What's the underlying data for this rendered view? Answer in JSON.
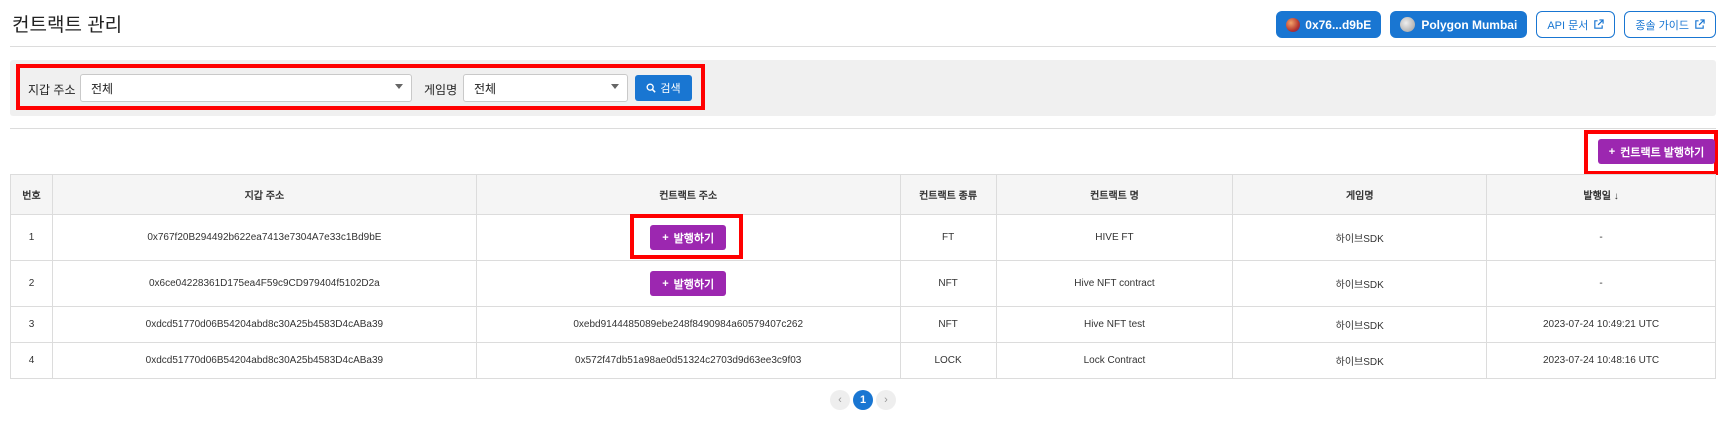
{
  "page": {
    "title": "컨트랙트 관리"
  },
  "header": {
    "wallet_label": "0x76...d9bE",
    "network_label": "Polygon Mumbai",
    "api_docs_label": "API 문서",
    "guide_label": "종솔 가이드"
  },
  "filter": {
    "wallet_label": "지갑 주소",
    "wallet_value": "전체",
    "game_label": "게임명",
    "game_value": "전체",
    "search_label": "검색"
  },
  "issue_contract_label": "컨트랙트 발행하기",
  "table": {
    "headers": [
      "번호",
      "지갑 주소",
      "컨트랙트 주소",
      "컨트랙트 종류",
      "컨트랙트 명",
      "게임명",
      "발행일 ↓"
    ],
    "issue_label": "발행하기",
    "rows": [
      {
        "no": "1",
        "wallet": "0x767f20B294492b622ea7413e7304A7e33c1Bd9bE",
        "contract": "",
        "type": "FT",
        "name": "HIVE FT",
        "game": "하이브SDK",
        "date": "-"
      },
      {
        "no": "2",
        "wallet": "0x6ce04228361D175ea4F59c9CD979404f5102D2a",
        "contract": "",
        "type": "NFT",
        "name": "Hive NFT contract",
        "game": "하이브SDK",
        "date": "-"
      },
      {
        "no": "3",
        "wallet": "0xdcd51770d06B54204abd8c30A25b4583D4cABa39",
        "contract": "0xebd9144485089ebe248f8490984a60579407c262",
        "type": "NFT",
        "name": "Hive NFT test",
        "game": "하이브SDK",
        "date": "2023-07-24 10:49:21 UTC"
      },
      {
        "no": "4",
        "wallet": "0xdcd51770d06B54204abd8c30A25b4583D4cABa39",
        "contract": "0x572f47db51a98ae0d51324c2703d9d63ee3c9f03",
        "type": "LOCK",
        "name": "Lock Contract",
        "game": "하이브SDK",
        "date": "2023-07-24 10:48:16 UTC"
      }
    ]
  },
  "pager": {
    "prev": "‹",
    "current": "1",
    "next": "›"
  },
  "colors": {
    "primary": "#1976d2",
    "purple": "#9c27b0",
    "highlight": "#ff0000"
  }
}
